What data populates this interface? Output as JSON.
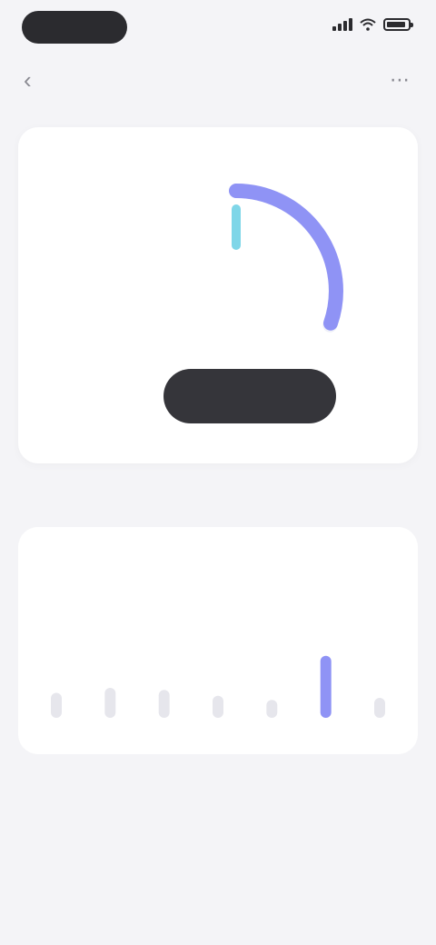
{
  "status_bar": {
    "time": "",
    "colors": {
      "pill": "#2b2b2f"
    }
  },
  "nav": {
    "title": "",
    "back_icon": "chevron-left-icon",
    "more_icon": "more-icon"
  },
  "main_card": {
    "label": "",
    "gauge": {
      "value": "",
      "caption": "",
      "progress": 0.33,
      "colors": {
        "track": "#eef0f8",
        "arc": "#8f93f5",
        "accent": "#7fd6e8"
      }
    },
    "hint": "",
    "button_label": ""
  },
  "section": {
    "title": ""
  },
  "history_card": {
    "title": "",
    "subtitle": "",
    "link_label": "",
    "days": [
      "",
      "",
      "",
      "",
      "",
      "",
      ""
    ],
    "levels": [
      0.25,
      0.3,
      0.28,
      0.22,
      0.18,
      0.62,
      0.2
    ],
    "selected_index": 5,
    "colors": {
      "bar": "#e6e6ec",
      "selected": "#8f93f5"
    }
  }
}
